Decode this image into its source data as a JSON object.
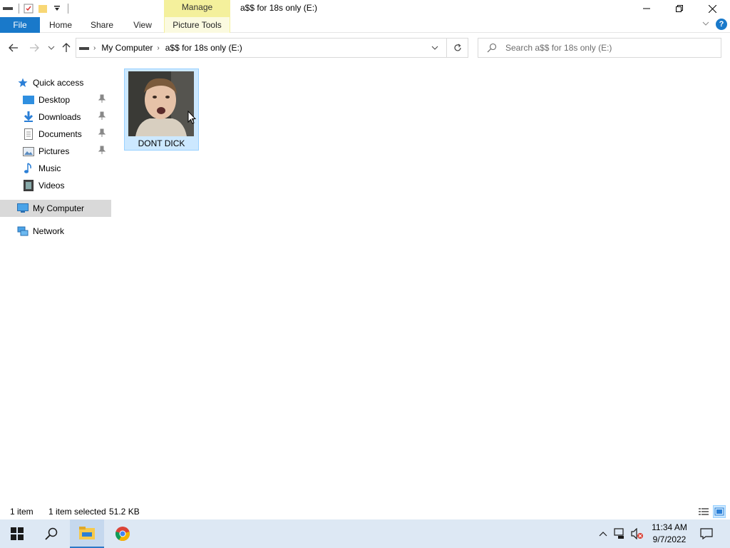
{
  "window": {
    "title": "a$$ for 18s only (E:)",
    "contextual_tab_group": "Manage"
  },
  "ribbon": {
    "tabs": [
      {
        "label": "File"
      },
      {
        "label": "Home"
      },
      {
        "label": "Share"
      },
      {
        "label": "View"
      },
      {
        "label": "Picture Tools"
      }
    ]
  },
  "address": {
    "crumbs": [
      "My Computer",
      "a$$ for 18s only (E:)"
    ]
  },
  "search": {
    "placeholder": "Search a$$ for 18s only (E:)"
  },
  "navpane": {
    "quick_access": "Quick access",
    "items": [
      {
        "label": "Desktop",
        "icon": "desktop-icon",
        "pinned": true
      },
      {
        "label": "Downloads",
        "icon": "downloads-icon",
        "pinned": true
      },
      {
        "label": "Documents",
        "icon": "documents-icon",
        "pinned": true
      },
      {
        "label": "Pictures",
        "icon": "pictures-icon",
        "pinned": true
      },
      {
        "label": "Music",
        "icon": "music-icon",
        "pinned": false
      },
      {
        "label": "Videos",
        "icon": "videos-icon",
        "pinned": false
      }
    ],
    "my_computer": "My Computer",
    "network": "Network"
  },
  "content": {
    "files": [
      {
        "name": "DONT DICK",
        "selected": true,
        "type": "image"
      }
    ]
  },
  "statusbar": {
    "item_count": "1 item",
    "selection": "1 item selected",
    "size": "51.2 KB"
  },
  "taskbar": {
    "time": "11:34 AM",
    "date": "9/7/2022"
  },
  "colors": {
    "accent": "#1979ca",
    "manage_tab": "#f4f09c",
    "selection_fill": "#cce8ff",
    "selection_border": "#99d1ff",
    "taskbar": "#dde8f4"
  }
}
